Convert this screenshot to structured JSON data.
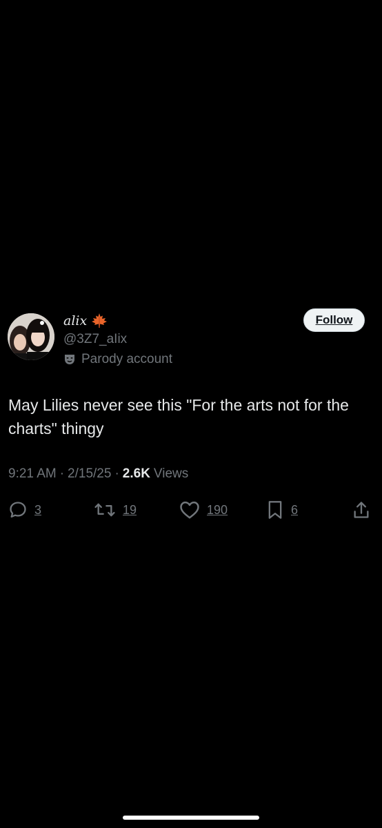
{
  "tweet": {
    "display_name": "alix",
    "name_emoji_icon": "maple-leaf-icon",
    "handle": "@3Z7_aIix",
    "parody_label": "Parody account",
    "follow_label": "Follow",
    "text": "May Lilies never see this \"For the arts not for the charts\" thingy",
    "time": "9:21 AM",
    "date": "2/15/25",
    "views_count": "2.6K",
    "views_label": "Views",
    "replies": "3",
    "reposts": "19",
    "likes": "190",
    "bookmarks": "6"
  },
  "colors": {
    "background": "#000000",
    "primary_text": "#e7e9ea",
    "secondary_text": "#71767b",
    "follow_bg": "#eff3f4"
  }
}
